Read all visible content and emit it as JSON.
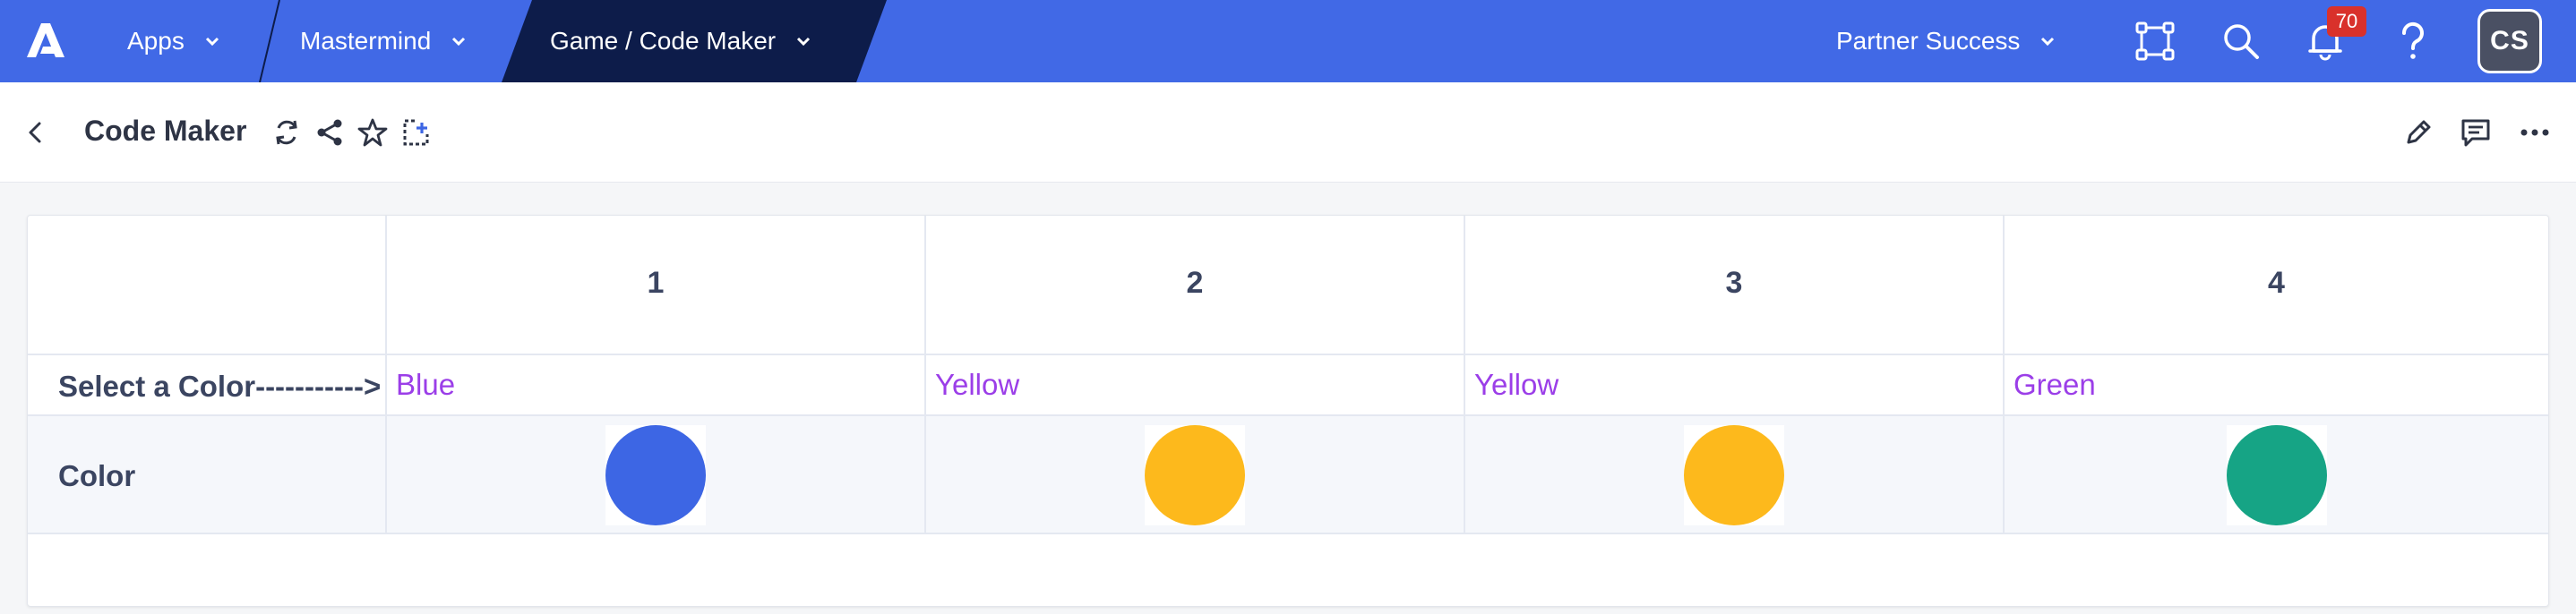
{
  "nav": {
    "apps_label": "Apps",
    "mastermind_label": "Mastermind",
    "active_tab_label": "Game / Code Maker",
    "workspace_label": "Partner Success",
    "notification_count": "70",
    "avatar_initials": "CS"
  },
  "page": {
    "title": "Code Maker"
  },
  "table": {
    "columns": [
      "1",
      "2",
      "3",
      "4"
    ],
    "select_row_label": "Select a Color----------->",
    "selected_colors": [
      "Blue",
      "Yellow",
      "Yellow",
      "Green"
    ],
    "color_row_label": "Color",
    "swatch_colors": [
      "#3d66e4",
      "#fdb91c",
      "#fdb91c",
      "#16a485"
    ]
  },
  "colors": {
    "nav_bg": "#4169e6",
    "active_tab_bg": "#0d1c4a",
    "value_text": "#9b3ee8",
    "badge": "#d9312b"
  }
}
